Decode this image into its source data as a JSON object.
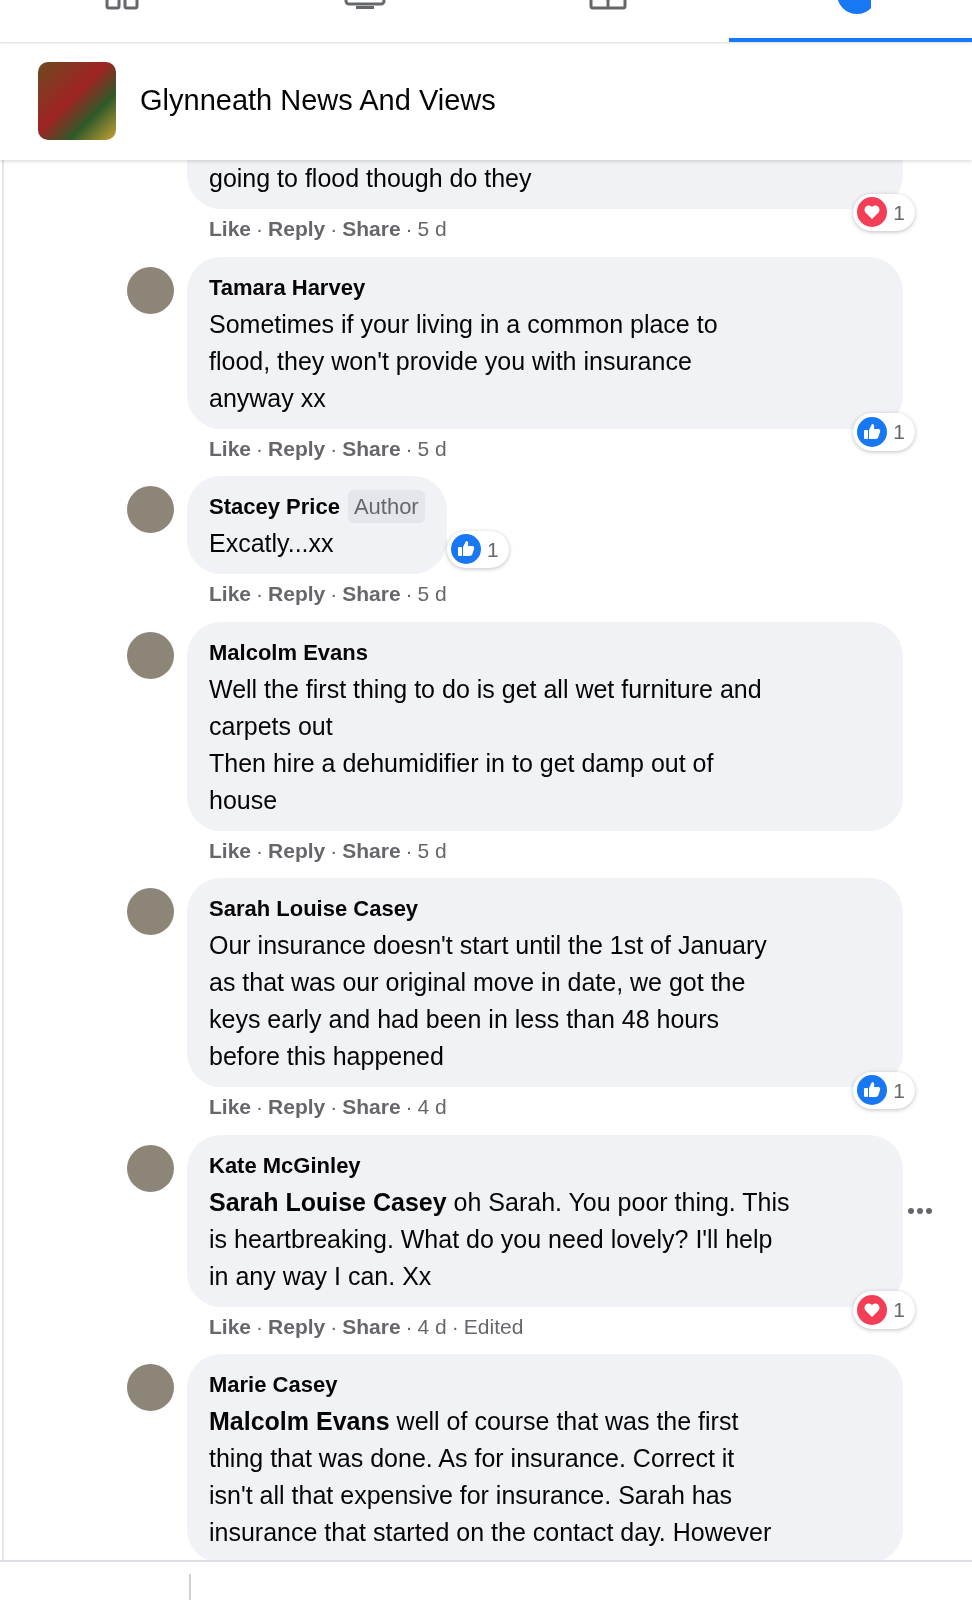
{
  "nav_tabs": [
    {
      "kind": "grid",
      "selected": false
    },
    {
      "kind": "screen",
      "selected": false
    },
    {
      "kind": "store",
      "selected": false
    },
    {
      "kind": "profile",
      "selected": true
    }
  ],
  "group_header": {
    "title": "Glynneath News And Views"
  },
  "comments": [
    {
      "lines": [
        "going to flood though do they"
      ],
      "reaction": {
        "kind": "love",
        "count": "1"
      },
      "actions": [
        {
          "kind": "link",
          "text": "Like"
        },
        {
          "kind": "dot",
          "text": "·"
        },
        {
          "kind": "link",
          "text": "Reply"
        },
        {
          "kind": "dot",
          "text": "·"
        },
        {
          "kind": "link",
          "text": "Share"
        },
        {
          "kind": "dot",
          "text": "·"
        },
        {
          "kind": "time",
          "text": "5 d"
        }
      ]
    },
    {
      "name": "Tamara Harvey",
      "lines": [
        "Sometimes if your living in a common place to",
        "flood, they won't provide you with insurance",
        "anyway xx"
      ],
      "reaction": {
        "kind": "like",
        "count": "1"
      },
      "actions": [
        {
          "kind": "link",
          "text": "Like"
        },
        {
          "kind": "dot",
          "text": "·"
        },
        {
          "kind": "link",
          "text": "Reply"
        },
        {
          "kind": "dot",
          "text": "·"
        },
        {
          "kind": "link",
          "text": "Share"
        },
        {
          "kind": "dot",
          "text": "·"
        },
        {
          "kind": "time",
          "text": "5 d"
        }
      ]
    },
    {
      "name": "Stacey Price",
      "badge": "Author",
      "lines": [
        "Excatly...xx"
      ],
      "reaction": {
        "kind": "like",
        "count": "1"
      },
      "actions": [
        {
          "kind": "link",
          "text": "Like"
        },
        {
          "kind": "dot",
          "text": "·"
        },
        {
          "kind": "link",
          "text": "Reply"
        },
        {
          "kind": "dot",
          "text": "·"
        },
        {
          "kind": "link",
          "text": "Share"
        },
        {
          "kind": "dot",
          "text": "·"
        },
        {
          "kind": "time",
          "text": "5 d"
        }
      ]
    },
    {
      "name": "Malcolm Evans",
      "lines": [
        "Well the first thing to do is get all wet furniture and",
        "carpets out",
        "Then hire a dehumidifier in to get damp out of",
        "house"
      ],
      "actions": [
        {
          "kind": "link",
          "text": "Like"
        },
        {
          "kind": "dot",
          "text": "·"
        },
        {
          "kind": "link",
          "text": "Reply"
        },
        {
          "kind": "dot",
          "text": "·"
        },
        {
          "kind": "link",
          "text": "Share"
        },
        {
          "kind": "dot",
          "text": "·"
        },
        {
          "kind": "time",
          "text": "5 d"
        }
      ]
    },
    {
      "name": "Sarah Louise Casey",
      "lines": [
        "Our insurance doesn't start until the 1st of January",
        "as that was our original move in date, we got the",
        "keys early and had been in less than 48 hours",
        "before this happened"
      ],
      "reaction": {
        "kind": "like",
        "count": "1"
      },
      "actions": [
        {
          "kind": "link",
          "text": "Like"
        },
        {
          "kind": "dot",
          "text": "·"
        },
        {
          "kind": "link",
          "text": "Reply"
        },
        {
          "kind": "dot",
          "text": "·"
        },
        {
          "kind": "link",
          "text": "Share"
        },
        {
          "kind": "dot",
          "text": "·"
        },
        {
          "kind": "time",
          "text": "4 d"
        }
      ]
    },
    {
      "name": "Kate McGinley",
      "lines": [
        "**Sarah Louise Casey** oh Sarah. You poor thing. This",
        "is heartbreaking. What do you need lovely? I'll help",
        "in any way I can. Xx"
      ],
      "reaction": {
        "kind": "love",
        "count": "1"
      },
      "menu": true,
      "actions": [
        {
          "kind": "link",
          "text": "Like"
        },
        {
          "kind": "dot",
          "text": "·"
        },
        {
          "kind": "link",
          "text": "Reply"
        },
        {
          "kind": "dot",
          "text": "·"
        },
        {
          "kind": "link",
          "text": "Share"
        },
        {
          "kind": "dot",
          "text": "·"
        },
        {
          "kind": "time",
          "text": "4 d"
        },
        {
          "kind": "dot",
          "text": "·"
        },
        {
          "kind": "note",
          "text": "Edited"
        }
      ]
    },
    {
      "name": "Marie Casey",
      "lines": [
        "**Malcolm Evans** well of course that was the first",
        "thing that was done. As for insurance. Correct it",
        "isn't all that expensive for insurance. Sarah has",
        "insurance that started on the contact day. However"
      ]
    }
  ]
}
